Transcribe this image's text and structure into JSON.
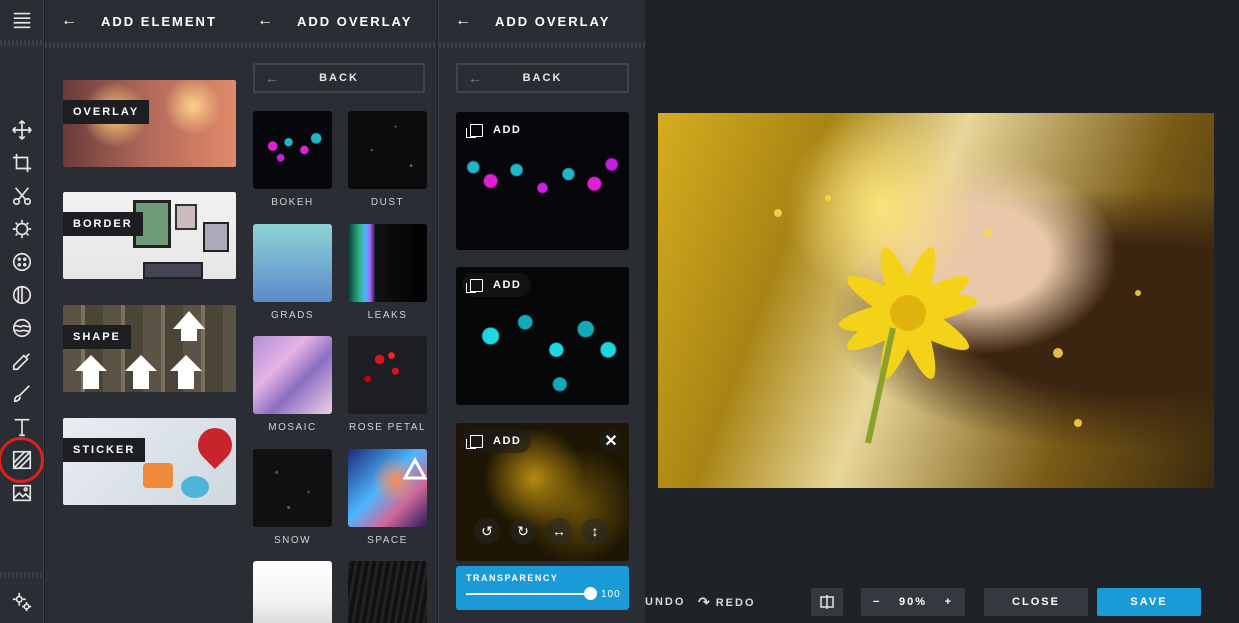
{
  "rail": {
    "tools": [
      "menu-icon",
      "move-icon",
      "crop-icon",
      "cut-icon",
      "exposure-icon",
      "filter-icon",
      "vignette-icon",
      "texture-icon",
      "dropper-icon",
      "brush-icon",
      "text-icon",
      "overlay-icon",
      "image-icon",
      "settings-icon"
    ]
  },
  "panel1": {
    "title": "ADD ELEMENT",
    "items": [
      {
        "label": "OVERLAY"
      },
      {
        "label": "BORDER"
      },
      {
        "label": "SHAPE"
      },
      {
        "label": "STICKER"
      }
    ]
  },
  "panel2": {
    "title": "ADD OVERLAY",
    "back_label": "BACK",
    "items": [
      {
        "label": "BOKEH"
      },
      {
        "label": "DUST"
      },
      {
        "label": "GRADS"
      },
      {
        "label": "LEAKS"
      },
      {
        "label": "MOSAIC"
      },
      {
        "label": "ROSE PETAL"
      },
      {
        "label": "SNOW"
      },
      {
        "label": "SPACE"
      }
    ]
  },
  "panel3": {
    "title": "ADD OVERLAY",
    "back_label": "BACK",
    "cards": [
      {
        "add_label": "ADD"
      },
      {
        "add_label": "ADD"
      },
      {
        "add_label": "ADD"
      }
    ],
    "transparency": {
      "label": "TRANSPARENCY",
      "value": "100",
      "fraction": 1.0
    }
  },
  "bottom": {
    "undo_label": "UNDO",
    "redo_label": "REDO",
    "zoom": "90%",
    "zoom_minus": "−",
    "zoom_plus": "+",
    "close_label": "CLOSE",
    "save_label": "SAVE"
  },
  "colors": {
    "accent": "#1a9bd7",
    "highlight": "#e0201c",
    "panel": "#2a2d33"
  }
}
